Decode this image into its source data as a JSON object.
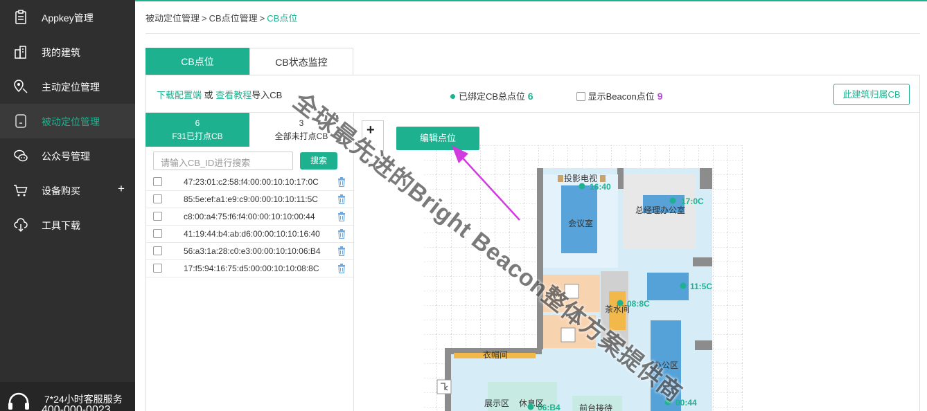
{
  "sidebar": {
    "items": [
      {
        "label": "Appkey管理",
        "icon": "clipboard-icon"
      },
      {
        "label": "我的建筑",
        "icon": "building-icon"
      },
      {
        "label": "主动定位管理",
        "icon": "location-icon"
      },
      {
        "label": "被动定位管理",
        "icon": "tablet-icon"
      },
      {
        "label": "公众号管理",
        "icon": "chat-icon"
      },
      {
        "label": "设备购买",
        "icon": "cart-icon",
        "expand": "+"
      },
      {
        "label": "工具下载",
        "icon": "cloud-download-icon"
      }
    ],
    "active_index": 3,
    "support": {
      "label": "7*24小时客服服务",
      "phone": "400-000-0023"
    }
  },
  "breadcrumb": {
    "items": [
      "被动定位管理",
      "CB点位管理",
      "CB点位"
    ],
    "separator": ">"
  },
  "tabs": [
    {
      "label": "CB点位",
      "active": true
    },
    {
      "label": "CB状态监控",
      "active": false
    }
  ],
  "import": {
    "download_link": "下载配置端",
    "or": "或",
    "tutorial_link": "查看教程",
    "suffix": "导入CB"
  },
  "bound": {
    "label": "已绑定CB总点位",
    "count": "6"
  },
  "beacon_toggle": {
    "label": "显示Beacon点位",
    "count": "9"
  },
  "owner_button": "此建筑归属CB",
  "subtabs": [
    {
      "count": "6",
      "label": "F31已打点CB",
      "active": true
    },
    {
      "count": "3",
      "label": "全部未打点CB",
      "active": false
    }
  ],
  "search": {
    "placeholder": "请输入CB_ID进行搜索",
    "button": "搜索"
  },
  "cb_list": [
    "47:23:01:c2:58:f4:00:00:10:10:17:0C",
    "85:5e:ef:a1:e9:c9:00:00:10:10:11:5C",
    "c8:00:a4:75:f6:f4:00:00:10:10:00:44",
    "41:19:44:b4:ab:d6:00:00:10:10:16:40",
    "56:a3:1a:28:c0:e3:00:00:10:10:06:B4",
    "17:f5:94:16:75:d5:00:00:10:10:08:8C"
  ],
  "map": {
    "zoom_in": "+",
    "edit_button": "编辑点位",
    "rooms": [
      "投影电视",
      "会议室",
      "总经理办公室",
      "茶水间",
      "衣帽间",
      "办公区",
      "展示区",
      "休息区",
      "前台接待"
    ],
    "markers": [
      "16:40",
      "17:0C",
      "11:5C",
      "08:8C",
      "00:44",
      "06:B4"
    ]
  },
  "watermark": "全球最先进的Bright Beacon整体方案提供商",
  "colors": {
    "accent": "#1db18f",
    "sidebar": "#2f2f2f",
    "beacon": "#b94bd9",
    "arrow": "#d23be0"
  }
}
